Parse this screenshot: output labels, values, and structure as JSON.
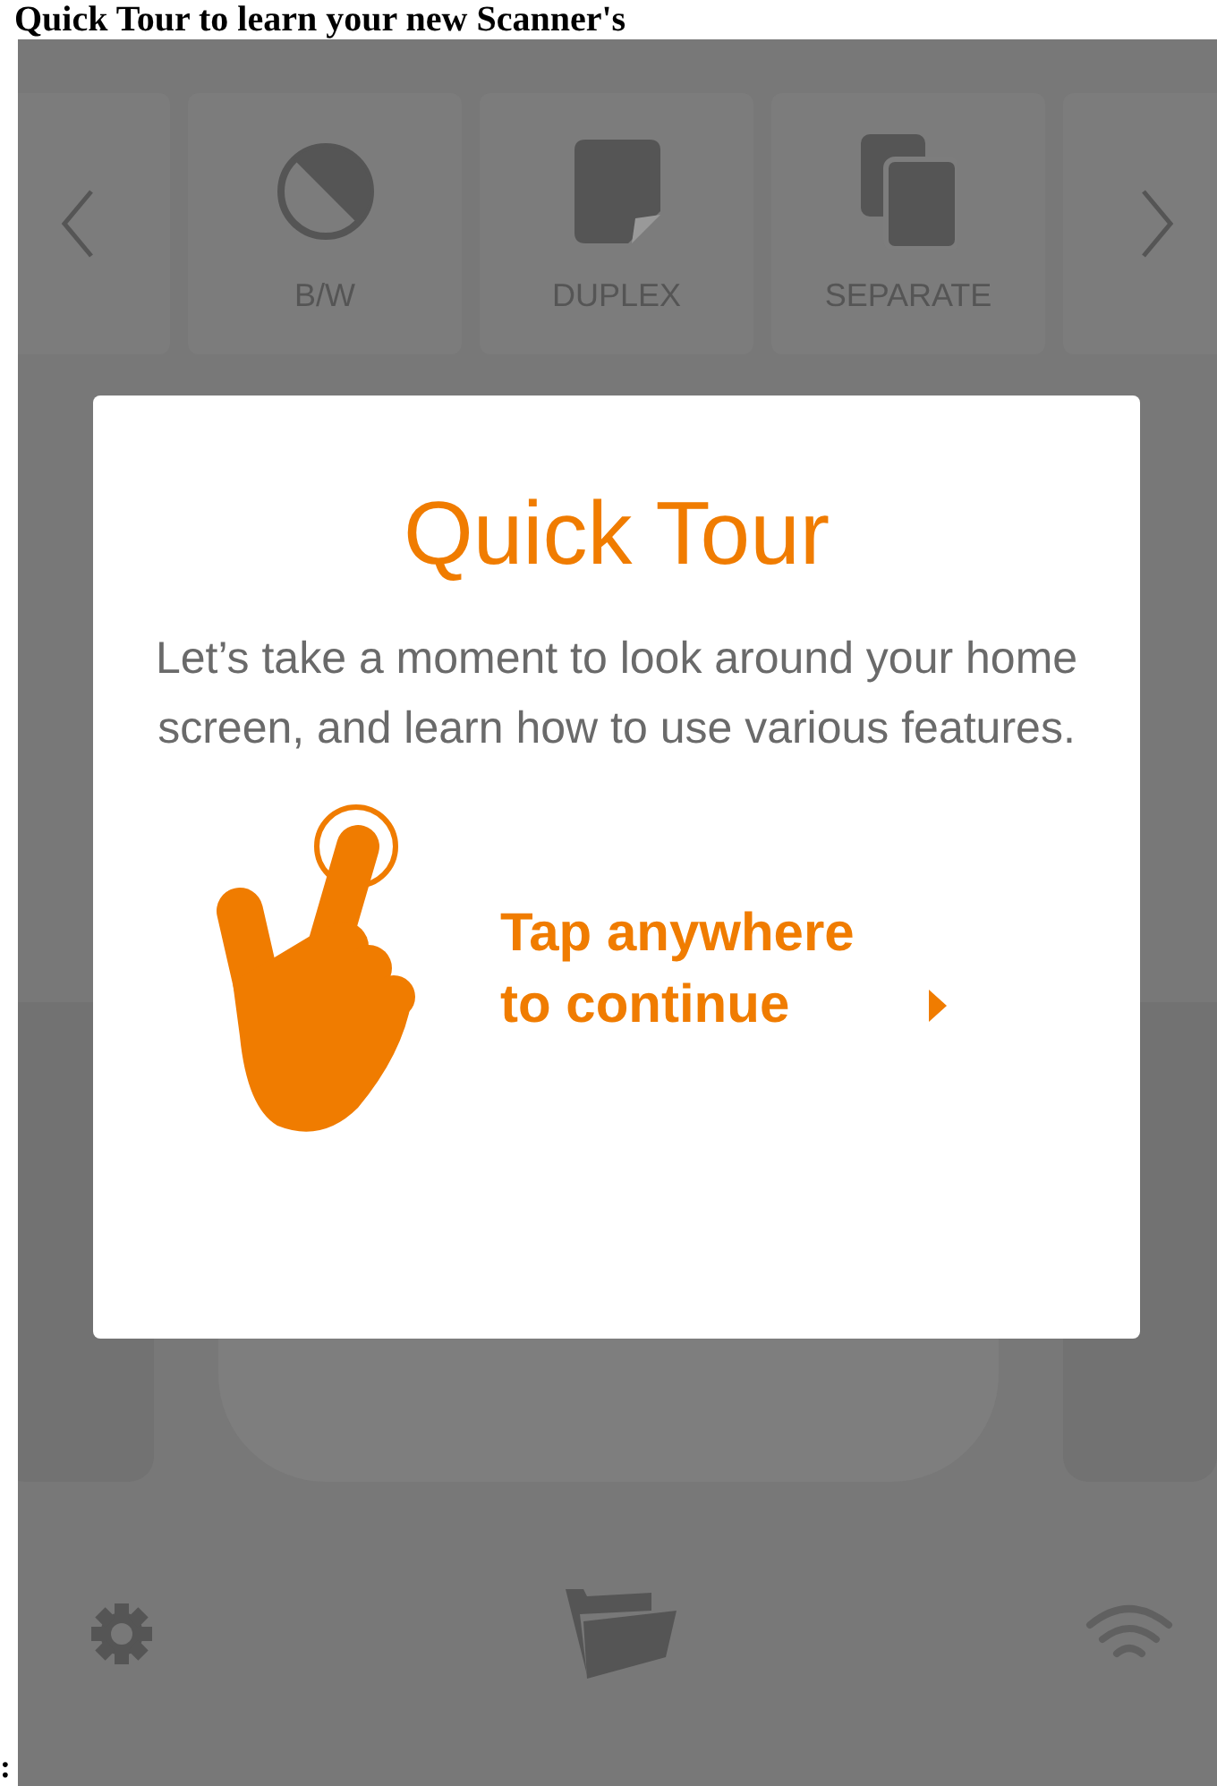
{
  "caption": "Quick Tour to learn your new Scanner's",
  "caption_end": ":",
  "toolbar": {
    "items": [
      {
        "label": "B/W",
        "kind": "bw"
      },
      {
        "label": "DUPLEX",
        "kind": "duplex"
      },
      {
        "label": "SEPARATE",
        "kind": "separate"
      }
    ]
  },
  "dialog": {
    "title": "Quick Tour",
    "message": "Let’s take a moment to look around your home screen, and learn how to use various features.",
    "hint": "Tap anywhere to continue"
  }
}
